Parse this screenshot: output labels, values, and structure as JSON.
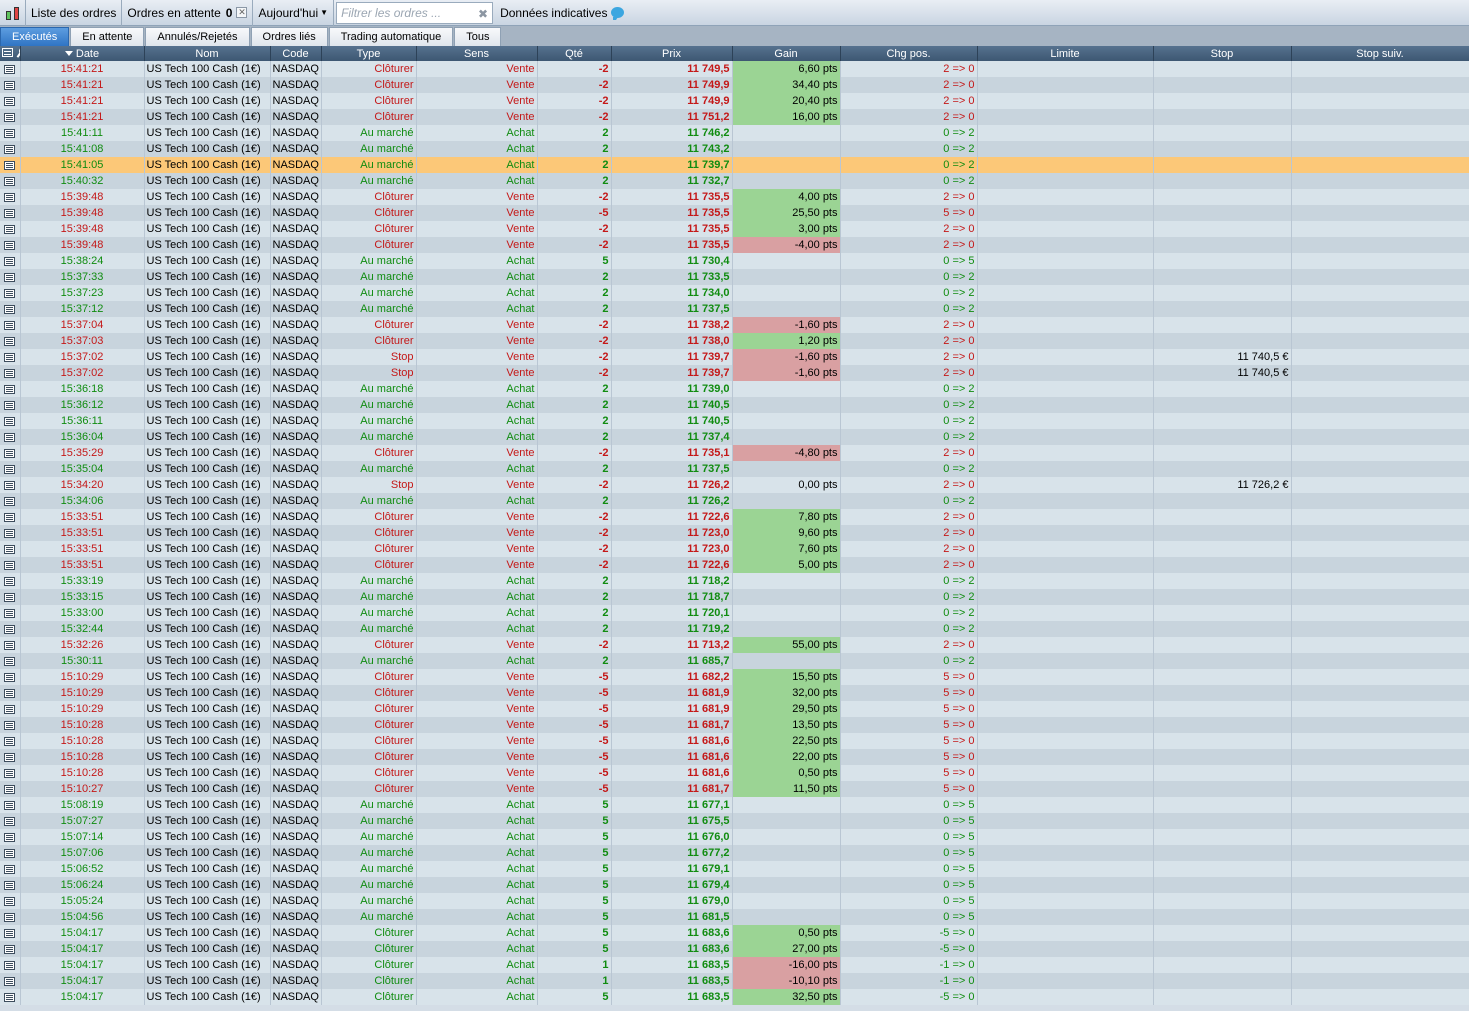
{
  "toolbar": {
    "orders_list_label": "Liste des ordres",
    "pending_label": "Ordres en attente",
    "pending_count": "0",
    "period_label": "Aujourd'hui",
    "filter_placeholder": "Filtrer les ordres ...",
    "indicative_label": "Données indicatives"
  },
  "tabs": [
    {
      "label": "Exécutés",
      "active": true
    },
    {
      "label": "En attente",
      "active": false
    },
    {
      "label": "Annulés/Rejetés",
      "active": false
    },
    {
      "label": "Ordres liés",
      "active": false
    },
    {
      "label": "Trading automatique",
      "active": false
    },
    {
      "label": "Tous",
      "active": false
    }
  ],
  "columns": {
    "date": "Date",
    "name": "Nom",
    "code": "Code",
    "type": "Type",
    "side": "Sens",
    "qty": "Qté",
    "price": "Prix",
    "gain": "Gain",
    "pos_change": "Chg pos.",
    "limit": "Limite",
    "stop": "Stop",
    "next_stop": "Stop suiv."
  },
  "colors": {
    "buy": "#108c10",
    "sell": "#c41818",
    "gain_positive": "#9bd494",
    "gain_negative": "#d9a0a2",
    "selected_row": "#fcc878"
  },
  "selected_row_index": 6,
  "rows": [
    [
      "15:41:21",
      "US Tech 100 Cash (1€)",
      "NASDAQ",
      "Clôturer",
      "Vente",
      "-2",
      "11 749,5",
      "6,60 pts",
      "2 => 0",
      ""
    ],
    [
      "15:41:21",
      "US Tech 100 Cash (1€)",
      "NASDAQ",
      "Clôturer",
      "Vente",
      "-2",
      "11 749,9",
      "34,40 pts",
      "2 => 0",
      ""
    ],
    [
      "15:41:21",
      "US Tech 100 Cash (1€)",
      "NASDAQ",
      "Clôturer",
      "Vente",
      "-2",
      "11 749,9",
      "20,40 pts",
      "2 => 0",
      ""
    ],
    [
      "15:41:21",
      "US Tech 100 Cash (1€)",
      "NASDAQ",
      "Clôturer",
      "Vente",
      "-2",
      "11 751,2",
      "16,00 pts",
      "2 => 0",
      ""
    ],
    [
      "15:41:11",
      "US Tech 100 Cash (1€)",
      "NASDAQ",
      "Au marché",
      "Achat",
      "2",
      "11 746,2",
      "",
      "0 => 2",
      ""
    ],
    [
      "15:41:08",
      "US Tech 100 Cash (1€)",
      "NASDAQ",
      "Au marché",
      "Achat",
      "2",
      "11 743,2",
      "",
      "0 => 2",
      ""
    ],
    [
      "15:41:05",
      "US Tech 100 Cash (1€)",
      "NASDAQ",
      "Au marché",
      "Achat",
      "2",
      "11 739,7",
      "",
      "0 => 2",
      ""
    ],
    [
      "15:40:32",
      "US Tech 100 Cash (1€)",
      "NASDAQ",
      "Au marché",
      "Achat",
      "2",
      "11 732,7",
      "",
      "0 => 2",
      ""
    ],
    [
      "15:39:48",
      "US Tech 100 Cash (1€)",
      "NASDAQ",
      "Clôturer",
      "Vente",
      "-2",
      "11 735,5",
      "4,00 pts",
      "2 => 0",
      ""
    ],
    [
      "15:39:48",
      "US Tech 100 Cash (1€)",
      "NASDAQ",
      "Clôturer",
      "Vente",
      "-5",
      "11 735,5",
      "25,50 pts",
      "5 => 0",
      ""
    ],
    [
      "15:39:48",
      "US Tech 100 Cash (1€)",
      "NASDAQ",
      "Clôturer",
      "Vente",
      "-2",
      "11 735,5",
      "3,00 pts",
      "2 => 0",
      ""
    ],
    [
      "15:39:48",
      "US Tech 100 Cash (1€)",
      "NASDAQ",
      "Clôturer",
      "Vente",
      "-2",
      "11 735,5",
      "-4,00 pts",
      "2 => 0",
      ""
    ],
    [
      "15:38:24",
      "US Tech 100 Cash (1€)",
      "NASDAQ",
      "Au marché",
      "Achat",
      "5",
      "11 730,4",
      "",
      "0 => 5",
      ""
    ],
    [
      "15:37:33",
      "US Tech 100 Cash (1€)",
      "NASDAQ",
      "Au marché",
      "Achat",
      "2",
      "11 733,5",
      "",
      "0 => 2",
      ""
    ],
    [
      "15:37:23",
      "US Tech 100 Cash (1€)",
      "NASDAQ",
      "Au marché",
      "Achat",
      "2",
      "11 734,0",
      "",
      "0 => 2",
      ""
    ],
    [
      "15:37:12",
      "US Tech 100 Cash (1€)",
      "NASDAQ",
      "Au marché",
      "Achat",
      "2",
      "11 737,5",
      "",
      "0 => 2",
      ""
    ],
    [
      "15:37:04",
      "US Tech 100 Cash (1€)",
      "NASDAQ",
      "Clôturer",
      "Vente",
      "-2",
      "11 738,2",
      "-1,60 pts",
      "2 => 0",
      ""
    ],
    [
      "15:37:03",
      "US Tech 100 Cash (1€)",
      "NASDAQ",
      "Clôturer",
      "Vente",
      "-2",
      "11 738,0",
      "1,20 pts",
      "2 => 0",
      ""
    ],
    [
      "15:37:02",
      "US Tech 100 Cash (1€)",
      "NASDAQ",
      "Stop",
      "Vente",
      "-2",
      "11 739,7",
      "-1,60 pts",
      "2 => 0",
      "11 740,5 €"
    ],
    [
      "15:37:02",
      "US Tech 100 Cash (1€)",
      "NASDAQ",
      "Stop",
      "Vente",
      "-2",
      "11 739,7",
      "-1,60 pts",
      "2 => 0",
      "11 740,5 €"
    ],
    [
      "15:36:18",
      "US Tech 100 Cash (1€)",
      "NASDAQ",
      "Au marché",
      "Achat",
      "2",
      "11 739,0",
      "",
      "0 => 2",
      ""
    ],
    [
      "15:36:12",
      "US Tech 100 Cash (1€)",
      "NASDAQ",
      "Au marché",
      "Achat",
      "2",
      "11 740,5",
      "",
      "0 => 2",
      ""
    ],
    [
      "15:36:11",
      "US Tech 100 Cash (1€)",
      "NASDAQ",
      "Au marché",
      "Achat",
      "2",
      "11 740,5",
      "",
      "0 => 2",
      ""
    ],
    [
      "15:36:04",
      "US Tech 100 Cash (1€)",
      "NASDAQ",
      "Au marché",
      "Achat",
      "2",
      "11 737,4",
      "",
      "0 => 2",
      ""
    ],
    [
      "15:35:29",
      "US Tech 100 Cash (1€)",
      "NASDAQ",
      "Clôturer",
      "Vente",
      "-2",
      "11 735,1",
      "-4,80 pts",
      "2 => 0",
      ""
    ],
    [
      "15:35:04",
      "US Tech 100 Cash (1€)",
      "NASDAQ",
      "Au marché",
      "Achat",
      "2",
      "11 737,5",
      "",
      "0 => 2",
      ""
    ],
    [
      "15:34:20",
      "US Tech 100 Cash (1€)",
      "NASDAQ",
      "Stop",
      "Vente",
      "-2",
      "11 726,2",
      "0,00 pts",
      "2 => 0",
      "11 726,2 €"
    ],
    [
      "15:34:06",
      "US Tech 100 Cash (1€)",
      "NASDAQ",
      "Au marché",
      "Achat",
      "2",
      "11 726,2",
      "",
      "0 => 2",
      ""
    ],
    [
      "15:33:51",
      "US Tech 100 Cash (1€)",
      "NASDAQ",
      "Clôturer",
      "Vente",
      "-2",
      "11 722,6",
      "7,80 pts",
      "2 => 0",
      ""
    ],
    [
      "15:33:51",
      "US Tech 100 Cash (1€)",
      "NASDAQ",
      "Clôturer",
      "Vente",
      "-2",
      "11 723,0",
      "9,60 pts",
      "2 => 0",
      ""
    ],
    [
      "15:33:51",
      "US Tech 100 Cash (1€)",
      "NASDAQ",
      "Clôturer",
      "Vente",
      "-2",
      "11 723,0",
      "7,60 pts",
      "2 => 0",
      ""
    ],
    [
      "15:33:51",
      "US Tech 100 Cash (1€)",
      "NASDAQ",
      "Clôturer",
      "Vente",
      "-2",
      "11 722,6",
      "5,00 pts",
      "2 => 0",
      ""
    ],
    [
      "15:33:19",
      "US Tech 100 Cash (1€)",
      "NASDAQ",
      "Au marché",
      "Achat",
      "2",
      "11 718,2",
      "",
      "0 => 2",
      ""
    ],
    [
      "15:33:15",
      "US Tech 100 Cash (1€)",
      "NASDAQ",
      "Au marché",
      "Achat",
      "2",
      "11 718,7",
      "",
      "0 => 2",
      ""
    ],
    [
      "15:33:00",
      "US Tech 100 Cash (1€)",
      "NASDAQ",
      "Au marché",
      "Achat",
      "2",
      "11 720,1",
      "",
      "0 => 2",
      ""
    ],
    [
      "15:32:44",
      "US Tech 100 Cash (1€)",
      "NASDAQ",
      "Au marché",
      "Achat",
      "2",
      "11 719,2",
      "",
      "0 => 2",
      ""
    ],
    [
      "15:32:26",
      "US Tech 100 Cash (1€)",
      "NASDAQ",
      "Clôturer",
      "Vente",
      "-2",
      "11 713,2",
      "55,00 pts",
      "2 => 0",
      ""
    ],
    [
      "15:30:11",
      "US Tech 100 Cash (1€)",
      "NASDAQ",
      "Au marché",
      "Achat",
      "2",
      "11 685,7",
      "",
      "0 => 2",
      ""
    ],
    [
      "15:10:29",
      "US Tech 100 Cash (1€)",
      "NASDAQ",
      "Clôturer",
      "Vente",
      "-5",
      "11 682,2",
      "15,50 pts",
      "5 => 0",
      ""
    ],
    [
      "15:10:29",
      "US Tech 100 Cash (1€)",
      "NASDAQ",
      "Clôturer",
      "Vente",
      "-5",
      "11 681,9",
      "32,00 pts",
      "5 => 0",
      ""
    ],
    [
      "15:10:29",
      "US Tech 100 Cash (1€)",
      "NASDAQ",
      "Clôturer",
      "Vente",
      "-5",
      "11 681,9",
      "29,50 pts",
      "5 => 0",
      ""
    ],
    [
      "15:10:28",
      "US Tech 100 Cash (1€)",
      "NASDAQ",
      "Clôturer",
      "Vente",
      "-5",
      "11 681,7",
      "13,50 pts",
      "5 => 0",
      ""
    ],
    [
      "15:10:28",
      "US Tech 100 Cash (1€)",
      "NASDAQ",
      "Clôturer",
      "Vente",
      "-5",
      "11 681,6",
      "22,50 pts",
      "5 => 0",
      ""
    ],
    [
      "15:10:28",
      "US Tech 100 Cash (1€)",
      "NASDAQ",
      "Clôturer",
      "Vente",
      "-5",
      "11 681,6",
      "22,00 pts",
      "5 => 0",
      ""
    ],
    [
      "15:10:28",
      "US Tech 100 Cash (1€)",
      "NASDAQ",
      "Clôturer",
      "Vente",
      "-5",
      "11 681,6",
      "0,50 pts",
      "5 => 0",
      ""
    ],
    [
      "15:10:27",
      "US Tech 100 Cash (1€)",
      "NASDAQ",
      "Clôturer",
      "Vente",
      "-5",
      "11 681,7",
      "11,50 pts",
      "5 => 0",
      ""
    ],
    [
      "15:08:19",
      "US Tech 100 Cash (1€)",
      "NASDAQ",
      "Au marché",
      "Achat",
      "5",
      "11 677,1",
      "",
      "0 => 5",
      ""
    ],
    [
      "15:07:27",
      "US Tech 100 Cash (1€)",
      "NASDAQ",
      "Au marché",
      "Achat",
      "5",
      "11 675,5",
      "",
      "0 => 5",
      ""
    ],
    [
      "15:07:14",
      "US Tech 100 Cash (1€)",
      "NASDAQ",
      "Au marché",
      "Achat",
      "5",
      "11 676,0",
      "",
      "0 => 5",
      ""
    ],
    [
      "15:07:06",
      "US Tech 100 Cash (1€)",
      "NASDAQ",
      "Au marché",
      "Achat",
      "5",
      "11 677,2",
      "",
      "0 => 5",
      ""
    ],
    [
      "15:06:52",
      "US Tech 100 Cash (1€)",
      "NASDAQ",
      "Au marché",
      "Achat",
      "5",
      "11 679,1",
      "",
      "0 => 5",
      ""
    ],
    [
      "15:06:24",
      "US Tech 100 Cash (1€)",
      "NASDAQ",
      "Au marché",
      "Achat",
      "5",
      "11 679,4",
      "",
      "0 => 5",
      ""
    ],
    [
      "15:05:24",
      "US Tech 100 Cash (1€)",
      "NASDAQ",
      "Au marché",
      "Achat",
      "5",
      "11 679,0",
      "",
      "0 => 5",
      ""
    ],
    [
      "15:04:56",
      "US Tech 100 Cash (1€)",
      "NASDAQ",
      "Au marché",
      "Achat",
      "5",
      "11 681,5",
      "",
      "0 => 5",
      ""
    ],
    [
      "15:04:17",
      "US Tech 100 Cash (1€)",
      "NASDAQ",
      "Clôturer",
      "Achat",
      "5",
      "11 683,6",
      "0,50 pts",
      "-5 => 0",
      ""
    ],
    [
      "15:04:17",
      "US Tech 100 Cash (1€)",
      "NASDAQ",
      "Clôturer",
      "Achat",
      "5",
      "11 683,6",
      "27,00 pts",
      "-5 => 0",
      ""
    ],
    [
      "15:04:17",
      "US Tech 100 Cash (1€)",
      "NASDAQ",
      "Clôturer",
      "Achat",
      "1",
      "11 683,5",
      "-16,00 pts",
      "-1 => 0",
      ""
    ],
    [
      "15:04:17",
      "US Tech 100 Cash (1€)",
      "NASDAQ",
      "Clôturer",
      "Achat",
      "1",
      "11 683,5",
      "-10,10 pts",
      "-1 => 0",
      ""
    ],
    [
      "15:04:17",
      "US Tech 100 Cash (1€)",
      "NASDAQ",
      "Clôturer",
      "Achat",
      "5",
      "11 683,5",
      "32,50 pts",
      "-5 => 0",
      ""
    ]
  ]
}
